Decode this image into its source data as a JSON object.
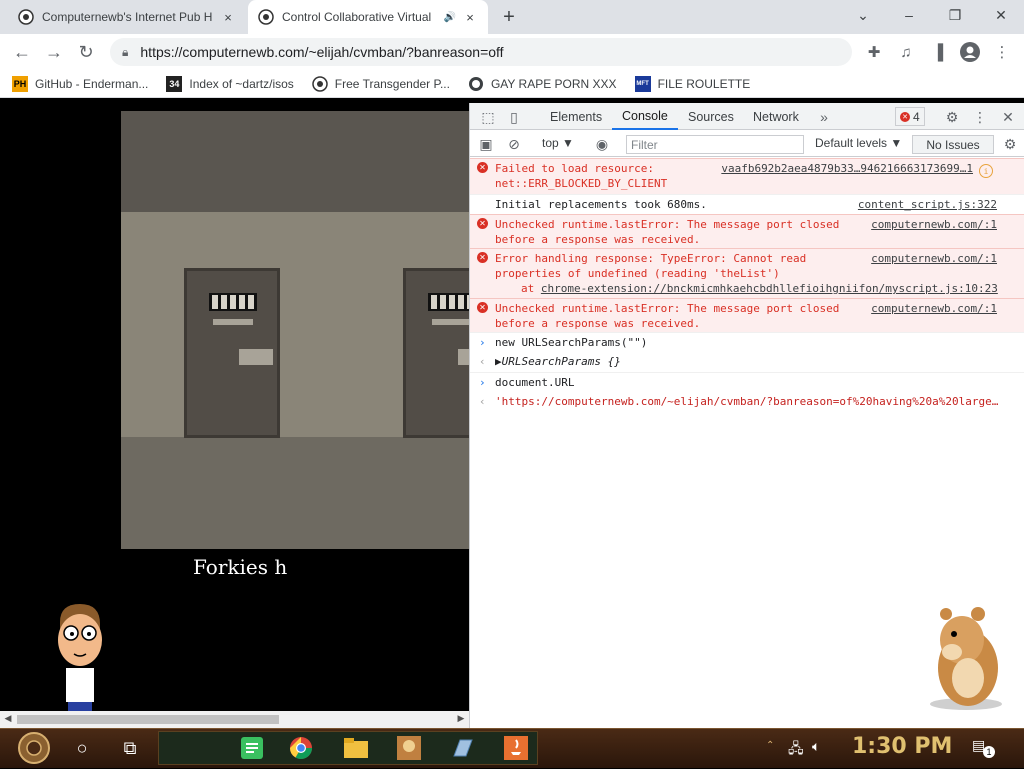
{
  "browser": {
    "tabs": [
      {
        "title": "Computernewb's Internet Pub H",
        "favicon": "computernewb-logo-icon",
        "close": "×",
        "active": false
      },
      {
        "title": "Control Collaborative Virtual",
        "favicon": "computernewb-logo-icon",
        "close": "×",
        "active": true,
        "audio": "🔊"
      }
    ],
    "new_tab": "+",
    "window_controls": {
      "minimize": "⌄",
      "minimize2": "–",
      "restore": "❐",
      "close": "✕"
    },
    "nav": {
      "back": "←",
      "forward": "→",
      "reload": "↻"
    },
    "url": "https://computernewb.com/~elijah/cvmban/?banreason=off",
    "bookmarks": [
      {
        "label": "GitHub - Enderman...",
        "icon": "PH",
        "icon_color": "#f0a000"
      },
      {
        "label": "Index of ~dartz/isos",
        "icon": "34",
        "icon_color": "#222222"
      },
      {
        "label": "Free Transgender P...",
        "icon": "computernewb-logo-icon",
        "icon_color": "#ffffff"
      },
      {
        "label": "GAY RAPE PORN XXX",
        "icon": "globe-icon",
        "icon_color": "#ffffff"
      },
      {
        "label": "FILE ROULETTE",
        "icon": "MFT",
        "icon_color": "#1a3a9a"
      }
    ]
  },
  "page": {
    "caption": "Forkies h"
  },
  "devtools": {
    "tabs": [
      "Elements",
      "Console",
      "Sources",
      "Network"
    ],
    "more": "»",
    "error_count": "4",
    "context": "top ▼",
    "filter_placeholder": "Filter",
    "levels": "Default levels ▼",
    "issues": "No Issues",
    "console": [
      {
        "type": "error",
        "msg": "Failed to load resource:\nnet::ERR_BLOCKED_BY_CLIENT",
        "src": "vaafb692b2aea4879b33…946216663173699…1"
      },
      {
        "type": "log",
        "msg": "Initial replacements took 680ms.",
        "src": "content_script.js:322"
      },
      {
        "type": "error",
        "msg": "Unchecked runtime.lastError: The message port closed\nbefore a response was received.",
        "src": "computernewb.com/:1"
      },
      {
        "type": "error",
        "msg": "Error handling response: TypeError: Cannot read\nproperties of undefined (reading 'theList')",
        "src": "computernewb.com/:1",
        "at_label": "at ",
        "at_link": "chrome-extension://bnckmicmhkaehcbdhllefioihgniifon/myscript.js:10:23"
      },
      {
        "type": "error",
        "msg": "Unchecked runtime.lastError: The message port closed\nbefore a response was received.",
        "src": "computernewb.com/:1"
      },
      {
        "type": "input",
        "msg": "new URLSearchParams(\"\")"
      },
      {
        "type": "output",
        "msg": "▶URLSearchParams {}"
      },
      {
        "type": "input",
        "msg": "document.URL"
      },
      {
        "type": "output",
        "msg": "'https://computernewb.com/~elijah/cvmban/?banreason=of%20having%20a%20large…"
      }
    ]
  },
  "taskbar": {
    "clock": "1:30 PM",
    "notification_count": "1"
  }
}
